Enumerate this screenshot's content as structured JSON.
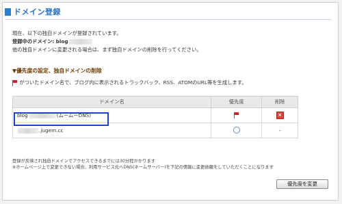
{
  "header": {
    "title": "ドメイン登録"
  },
  "intro": {
    "line1": "現在、以下の独自ドメインが登録されています。",
    "registered_label": "登録中のドメイン:",
    "registered_value": "blog",
    "line3": "他の独自ドメインに変更される場合は、まず独自ドメインの削除を行ってください。"
  },
  "section": {
    "heading": "▼優先度の設定、独自ドメインの削除",
    "desc": "がついたドメイン名で、ブログ内に表示されるトラックバック、RSS、ATOMのURL等を生成します。"
  },
  "table": {
    "headers": [
      "ドメイン名",
      "優先度",
      "削除"
    ],
    "rows": [
      {
        "domain_prefix": "blog",
        "domain_suffix": "(ムームーDNS)",
        "priority": "flag",
        "delete": "x"
      },
      {
        "domain_prefix": "",
        "domain_suffix": ".jugem.cc",
        "priority": "radio",
        "delete": "-"
      }
    ]
  },
  "notes": {
    "line1": "登録が反映され独自ドメインでアクセスできるまでには30分程かかります",
    "line2": "※ホームページ上で変更できない場合、利用サービス元へDNS(ネームサーバー)を下記の情報に変更依頼をしていただくことになります"
  },
  "buttons": {
    "change_priority": "優先度を変更"
  },
  "colors": {
    "accent": "#2a6fc0",
    "highlight": "#1f3fd6",
    "delete": "#d9433a"
  }
}
